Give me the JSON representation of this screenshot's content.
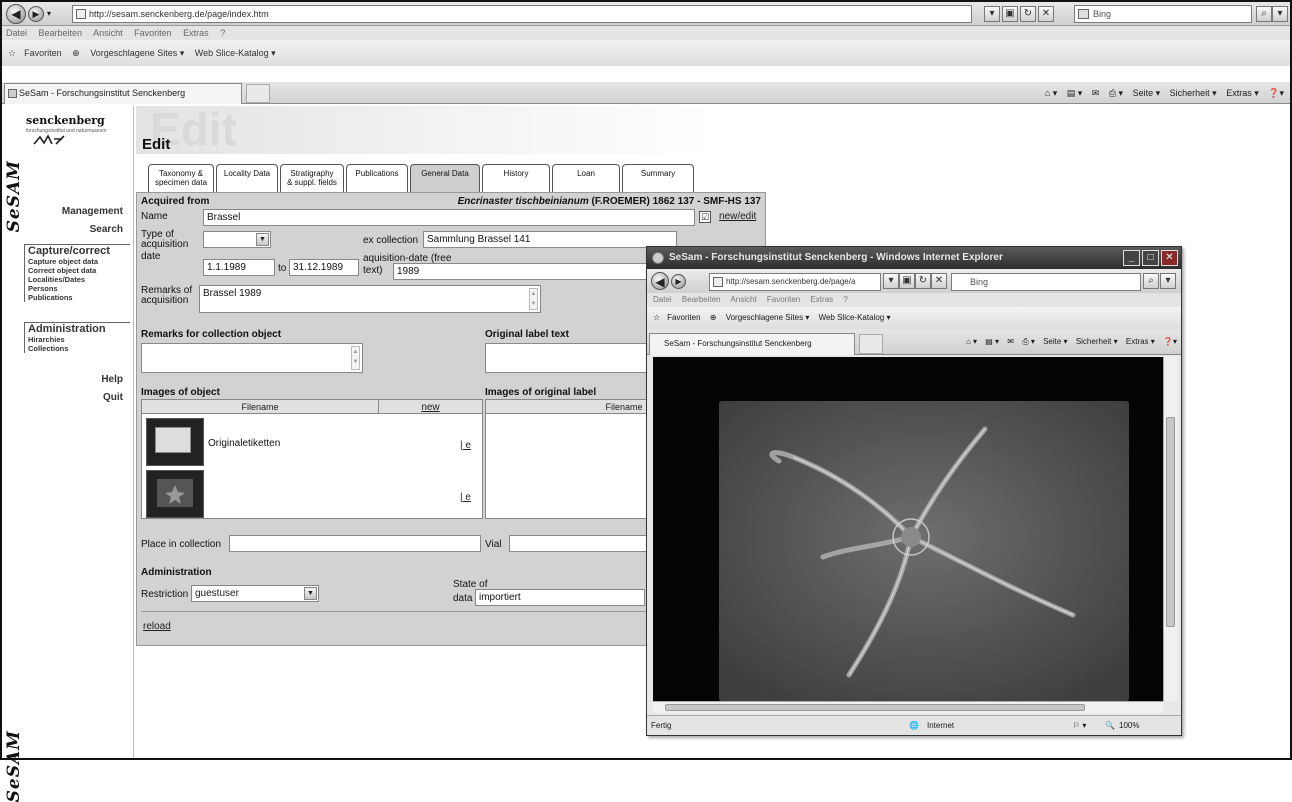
{
  "browser": {
    "url": "http://sesam.senckenberg.de/page/index.htm",
    "search_placeholder": "Bing",
    "menu": [
      "Datei",
      "Bearbeiten",
      "Ansicht",
      "Favoriten",
      "Extras",
      "?"
    ],
    "favorites": [
      "Favoriten",
      "Vorgeschlagene Sites ▾",
      "Web Slice-Katalog ▾"
    ],
    "tab_title": "SeSam - Forschungsinstitut Senckenberg",
    "commands": [
      "Seite ▾",
      "Sicherheit ▾",
      "Extras ▾"
    ]
  },
  "sidebar": {
    "logo_name": "senckenberg",
    "logo_sub": "forschungsinstitut und naturmuseum",
    "brand": "SeSAM",
    "items": [
      {
        "label": "Management"
      },
      {
        "label": "Search"
      }
    ],
    "capture": {
      "title": "Capture/correct",
      "items": [
        "Capture object data",
        "Correct object data",
        "Localities/Dates",
        "Persons",
        "Publications"
      ]
    },
    "administration": {
      "title": "Administration",
      "items": [
        "Hirarchies",
        "Collections"
      ]
    },
    "help": "Help",
    "quit": "Quit"
  },
  "page": {
    "banner_ghost": "Edit",
    "title": "Edit",
    "tabs": [
      [
        "Taxonomy &",
        "specimen data"
      ],
      [
        "Locality Data"
      ],
      [
        "Stratigraphy",
        "& suppl. fields"
      ],
      [
        "Publications"
      ],
      [
        "General Data"
      ],
      [
        "History"
      ],
      [
        "Loan"
      ],
      [
        "Summary"
      ]
    ],
    "active_tab": 4
  },
  "form": {
    "acquired_from_label": "Acquired from",
    "specimen_title": "Encrinaster tischbeinianum",
    "specimen_author": "(F.ROEMER) 1862   137 - SMF-HS 137",
    "name_label": "Name",
    "name_value": "Brassel",
    "new_edit": "new/edit",
    "type_label1": "Type of",
    "type_label2": "acquisition",
    "ex_collection_label": "ex collection",
    "ex_collection_value": "Sammlung Brassel  141",
    "date_label": "date",
    "date_from": "1.1.1989",
    "to_label": "to",
    "date_to": "31.12.1989",
    "aqdate_label1": "aquisition-date (free",
    "aqdate_label2": "text)",
    "aqdate_value": "1989",
    "remarks_acq_label1": "Remarks of",
    "remarks_acq_label2": "acquisition",
    "remarks_acq_value": "Brassel 1989",
    "remarks_obj_label": "Remarks for collection object",
    "orig_label_label": "Original label text",
    "images_obj_label": "Images of object",
    "images_orig_label": "Images of original label",
    "filename_col": "Filename",
    "new_link": "new",
    "images": [
      {
        "filename": "Originaletiketten",
        "action": "| e"
      },
      {
        "filename": "",
        "action": "| e"
      }
    ],
    "place_label": "Place in collection",
    "vial_label": "Vial",
    "admin_label": "Administration",
    "restriction_label": "Restriction",
    "restriction_value": "guestuser",
    "state_label1": "State of",
    "state_label2": "data",
    "state_value": "importiert",
    "reload": "reload"
  },
  "popup": {
    "title": "SeSam - Forschungsinstitut Senckenberg - Windows Internet Explorer",
    "url": "http://sesam.senckenberg.de/page/a",
    "search_placeholder": "Bing",
    "menu": [
      "Datei",
      "Bearbeiten",
      "Ansicht",
      "Favoriten",
      "Extras",
      "?"
    ],
    "favorites": [
      "Favoriten",
      "Vorgeschlagene Sites ▾",
      "Web Slice-Katalog ▾"
    ],
    "tab_title": "SeSam - Forschungsinstitut Senckenberg",
    "commands": [
      "Seite ▾",
      "Sicherheit ▾",
      "Extras ▾"
    ],
    "status_left": "Fertig",
    "status_zone": "Internet",
    "zoom": "100%"
  }
}
